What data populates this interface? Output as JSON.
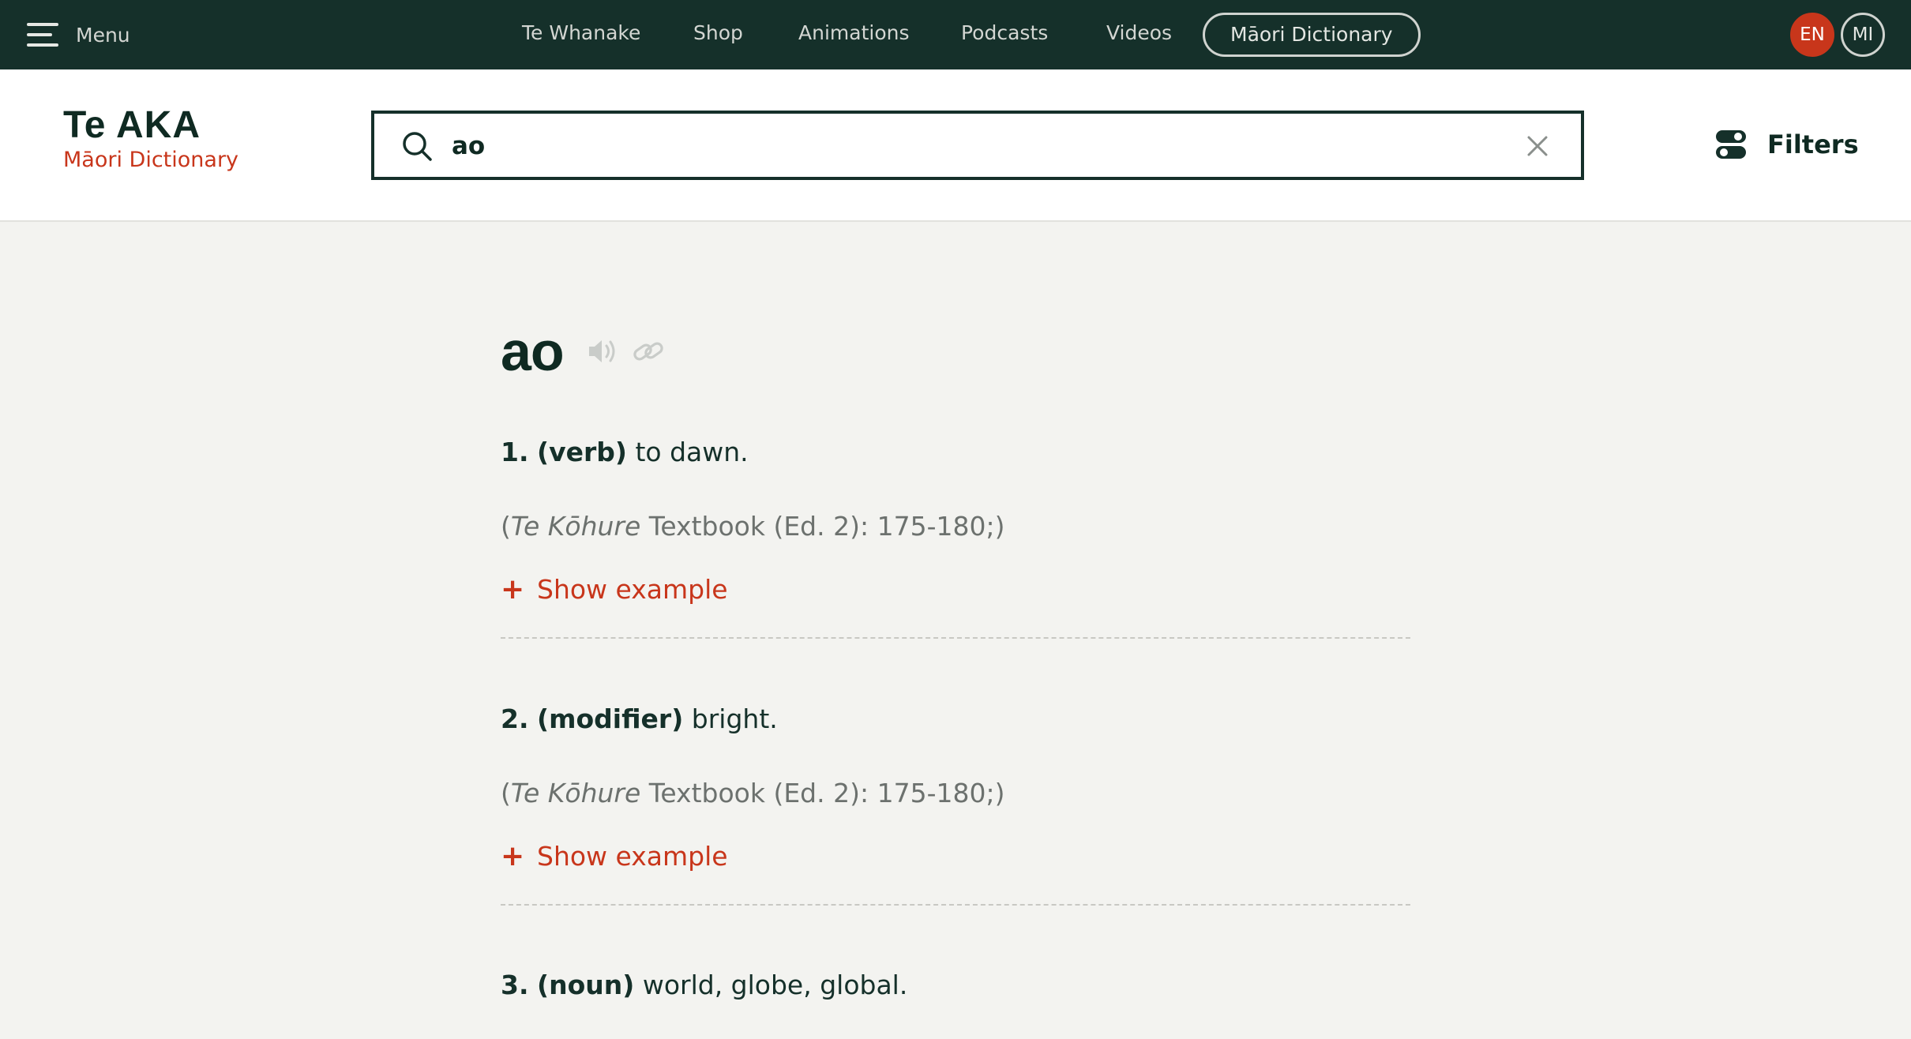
{
  "topbar": {
    "menu_label": "Menu",
    "nav": [
      "Te Whanake",
      "Shop",
      "Animations",
      "Podcasts",
      "Videos",
      "Māori Dictionary"
    ],
    "active_nav": "Māori Dictionary",
    "lang_en": "EN",
    "lang_mi": "MI"
  },
  "header": {
    "logo_main": "Te AKA",
    "logo_sub": "Māori Dictionary",
    "search_value": "ao",
    "filters_label": "Filters"
  },
  "entry": {
    "headword": "ao",
    "icons": [
      "speaker-icon",
      "link-icon"
    ],
    "senses": [
      {
        "number": "1.",
        "pos": "(verb)",
        "definition": "to dawn.",
        "source_open": "(",
        "source_title": "Te Kōhure",
        "source_rest": "Textbook (Ed. 2): 175-180;)",
        "example_label": "Show example"
      },
      {
        "number": "2.",
        "pos": "(modifier)",
        "definition": "bright.",
        "source_open": "(",
        "source_title": "Te Kōhure",
        "source_rest": "Textbook (Ed. 2): 175-180;)",
        "example_label": "Show example"
      },
      {
        "number": "3.",
        "pos": "(noun)",
        "definition": "world, globe, global."
      }
    ]
  },
  "colors": {
    "topbar_bg": "#15302a",
    "accent_red": "#c8361b",
    "text_dark": "#0f2a22",
    "page_bg": "#f3f3f0"
  }
}
